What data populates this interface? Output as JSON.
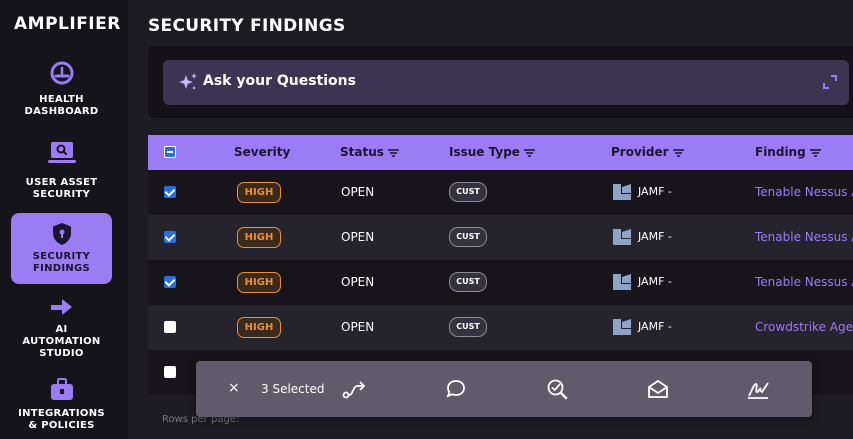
{
  "app": {
    "logo": "AMPLIFIER"
  },
  "sidebar": {
    "items": [
      {
        "label_line1": "HEALTH",
        "label_line2": "DASHBOARD",
        "icon": "gauge-icon"
      },
      {
        "label_line1": "USER ASSET",
        "label_line2": "SECURITY",
        "icon": "laptop-search-icon"
      },
      {
        "label_line1": "SECURITY",
        "label_line2": "FINDINGS",
        "icon": "shield-lock-icon",
        "active": true
      },
      {
        "label_line1": "AI",
        "label_line2": "AUTOMATION",
        "label_line3": "STUDIO",
        "icon": "arrow-right-icon"
      },
      {
        "label_line1": "INTEGRATIONS",
        "label_line2": "& POLICIES",
        "icon": "toolbox-icon"
      }
    ]
  },
  "main": {
    "title": "SECURITY FINDINGS",
    "ask": {
      "label": "Ask your Questions"
    }
  },
  "table": {
    "columns": [
      "Severity",
      "Status",
      "Issue Type",
      "Provider",
      "Finding"
    ],
    "rows": [
      {
        "checked": true,
        "severity": "HIGH",
        "status": "OPEN",
        "issue_type": "CUST",
        "provider": "JAMF -",
        "finding": "Tenable Nessus A"
      },
      {
        "checked": true,
        "severity": "HIGH",
        "status": "OPEN",
        "issue_type": "CUST",
        "provider": "JAMF -",
        "finding": "Tenable Nessus A"
      },
      {
        "checked": true,
        "severity": "HIGH",
        "status": "OPEN",
        "issue_type": "CUST",
        "provider": "JAMF -",
        "finding": "Tenable Nessus A"
      },
      {
        "checked": false,
        "severity": "HIGH",
        "status": "OPEN",
        "issue_type": "CUST",
        "provider": "JAMF -",
        "finding": "Crowdstrike Agen"
      }
    ],
    "footer": {
      "rows_per_page": "Rows per page:"
    }
  },
  "selection_bar": {
    "close": "×",
    "count_label": "3 Selected",
    "actions": [
      "route-icon",
      "comment-icon",
      "verify-icon",
      "mail-open-icon",
      "signature-icon"
    ]
  },
  "colors": {
    "accent": "#9b7cf5",
    "severity_high": "#e8903a",
    "checkbox": "#2a6fdb"
  }
}
